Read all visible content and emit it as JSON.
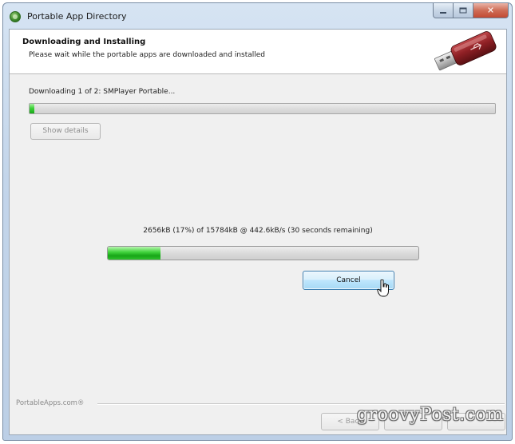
{
  "window": {
    "title": "Portable App Directory",
    "controls": {
      "minimize": "minimize",
      "maximize": "maximize",
      "close": "✕"
    }
  },
  "header": {
    "title": "Downloading and Installing",
    "subtitle": "Please wait while the portable apps are downloaded and installed"
  },
  "download": {
    "status_text": "Downloading 1 of 2: SMPlayer Portable...",
    "overall_progress": 0.01,
    "show_details_label": "Show details",
    "detail_text": "2656kB (17%) of 15784kB @ 442.6kB/s (30 seconds remaining)",
    "file_progress": 0.17,
    "cancel_label": "Cancel"
  },
  "footer": {
    "brand": "PortableApps.com®",
    "back_label": "< Back",
    "next_label": "",
    "cancel_label": "",
    "watermark": "groovyPost.com"
  },
  "icons": [
    "app-logo-icon",
    "usb-drive-icon",
    "mouse-cursor-icon"
  ],
  "colors": {
    "progress_green": "#18a818",
    "cancel_button_blue": "#a7d9f5"
  }
}
